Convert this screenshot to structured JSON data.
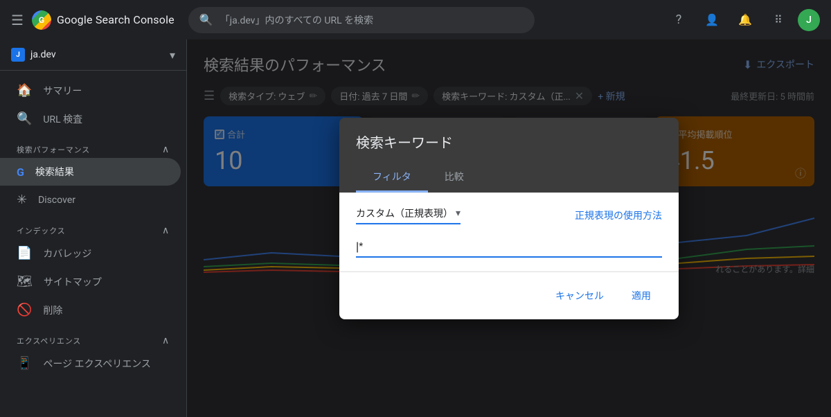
{
  "app": {
    "name": "Google Search Console"
  },
  "header": {
    "hamburger_label": "☰",
    "logo_letter": "G",
    "logo_text": "Google Search Console",
    "search_placeholder": "「ja.dev」内のすべての URL を検索",
    "icons": {
      "help": "?",
      "person": "👤",
      "bell": "🔔",
      "apps": "⠿",
      "avatar_letter": "J"
    }
  },
  "sidebar": {
    "property": {
      "icon": "J",
      "name": "ja.dev",
      "chevron": "▾"
    },
    "nav_items": [
      {
        "id": "summary",
        "label": "サマリー",
        "icon": "🏠"
      },
      {
        "id": "url-inspection",
        "label": "URL 検査",
        "icon": "🔍"
      }
    ],
    "sections": [
      {
        "id": "search-performance",
        "label": "検索パフォーマンス",
        "chevron": "∧",
        "items": [
          {
            "id": "search-results",
            "label": "検索結果",
            "icon": "G"
          },
          {
            "id": "discover",
            "label": "Discover",
            "icon": "✳"
          }
        ]
      },
      {
        "id": "index",
        "label": "インデックス",
        "chevron": "∧",
        "items": [
          {
            "id": "coverage",
            "label": "カバレッジ",
            "icon": "📄"
          },
          {
            "id": "sitemaps",
            "label": "サイトマップ",
            "icon": "🗺"
          },
          {
            "id": "removals",
            "label": "削除",
            "icon": "🚫"
          }
        ]
      },
      {
        "id": "experience",
        "label": "エクスペリエンス",
        "chevron": "∧",
        "items": [
          {
            "id": "page-experience",
            "label": "ページ エクスペリエンス",
            "icon": "📱"
          }
        ]
      }
    ]
  },
  "main": {
    "page_title": "検索結果のパフォーマンス",
    "export_label": "エクスポート",
    "filter_bar": {
      "chips": [
        {
          "id": "search-type",
          "label": "検索タイプ: ウェブ",
          "has_edit": true,
          "has_close": false
        },
        {
          "id": "date",
          "label": "日付: 過去 7 日間",
          "has_edit": true,
          "has_close": false
        },
        {
          "id": "keyword",
          "label": "検索キーワード: カスタム（正...",
          "has_edit": false,
          "has_close": true
        }
      ],
      "new_label": "+ 新規",
      "last_updated": "最終更新日: 5 時間前"
    },
    "metrics": [
      {
        "id": "total-clicks",
        "label": "合計",
        "value": "10",
        "color": "blue"
      },
      {
        "id": "avg-position",
        "label": "平均掲載順位",
        "value": "41.5",
        "color": "amber"
      }
    ],
    "chart_note": "れることがあります。詳細"
  },
  "modal": {
    "title": "検索キーワード",
    "tabs": [
      {
        "id": "filter",
        "label": "フィルタ",
        "active": true
      },
      {
        "id": "compare",
        "label": "比較",
        "active": false
      }
    ],
    "filter": {
      "type_label": "カスタム（正規表現）",
      "chevron": "▾",
      "help_link_label": "正規表現の使用方法",
      "input_value": "|*",
      "input_placeholder": ""
    },
    "buttons": {
      "cancel": "キャンセル",
      "apply": "適用"
    }
  }
}
